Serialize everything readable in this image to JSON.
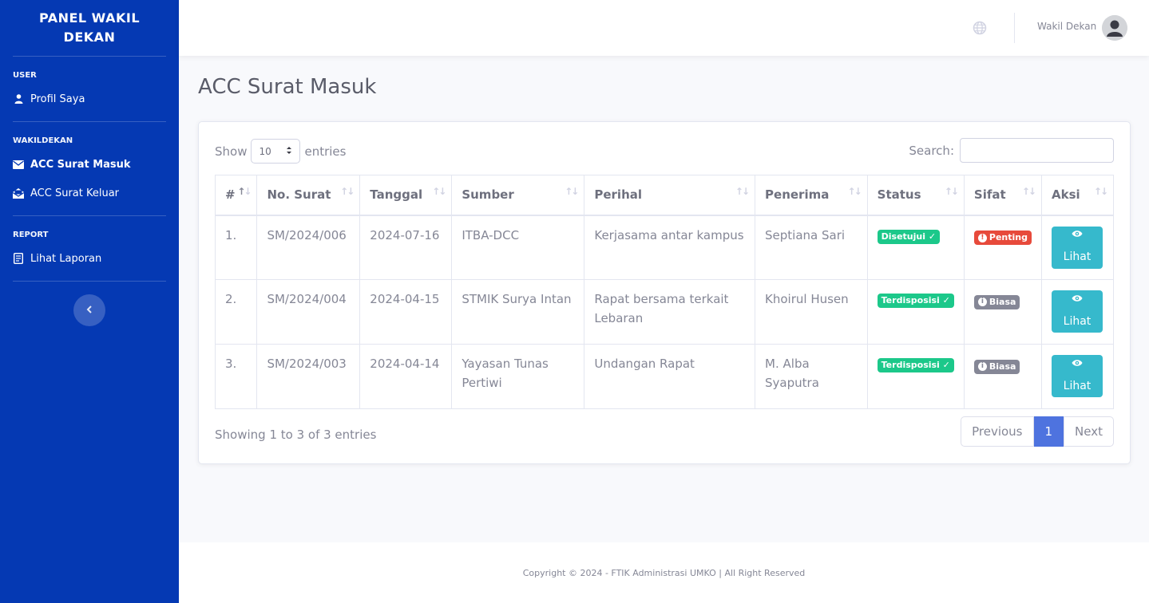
{
  "sidebar": {
    "brand": "PANEL WAKIL DEKAN",
    "sections": [
      {
        "heading": "USER",
        "items": [
          {
            "label": "Profil Saya",
            "icon": "user-icon"
          }
        ]
      },
      {
        "heading": "WAKILDEKAN",
        "items": [
          {
            "label": "ACC Surat Masuk",
            "icon": "envelope-icon"
          },
          {
            "label": "ACC Surat Keluar",
            "icon": "envelope-open-icon"
          }
        ]
      },
      {
        "heading": "REPORT",
        "items": [
          {
            "label": "Lihat Laporan",
            "icon": "report-icon"
          }
        ]
      }
    ],
    "toggle_icon": "chevron-left-icon"
  },
  "topbar": {
    "user_name": "Wakil Dekan"
  },
  "page": {
    "title": "ACC Surat Masuk"
  },
  "table_controls": {
    "show_label": "Show",
    "entries_value": "10",
    "entries_label": "entries",
    "search_label": "Search:",
    "search_value": ""
  },
  "table": {
    "columns": [
      "#",
      "No. Surat",
      "Tanggal",
      "Sumber",
      "Perihal",
      "Penerima",
      "Status",
      "Sifat",
      "Aksi"
    ],
    "rows": [
      {
        "no": "1.",
        "no_surat": "SM/2024/006",
        "tanggal": "2024-07-16",
        "sumber": "ITBA-DCC",
        "perihal": "Kerjasama antar kampus",
        "penerima": "Septiana Sari",
        "status": "Disetujui",
        "sifat": "Penting",
        "aksi": "Lihat"
      },
      {
        "no": "2.",
        "no_surat": "SM/2024/004",
        "tanggal": "2024-04-15",
        "sumber": "STMIK Surya Intan",
        "perihal": "Rapat bersama terkait Lebaran",
        "penerima": "Khoirul Husen",
        "status": "Terdisposisi",
        "sifat": "Biasa",
        "aksi": "Lihat"
      },
      {
        "no": "3.",
        "no_surat": "SM/2024/003",
        "tanggal": "2024-04-14",
        "sumber": "Yayasan Tunas Pertiwi",
        "perihal": "Undangan Rapat",
        "penerima": "M. Alba Syaputra",
        "status": "Terdisposisi",
        "sifat": "Biasa",
        "aksi": "Lihat"
      }
    ]
  },
  "table_info": "Showing 1 to 3 of 3 entries",
  "pagination": {
    "previous": "Previous",
    "current": "1",
    "next": "Next"
  },
  "footer": {
    "text": "Copyright © 2024 - FTIK Administrasi UMKO | All Right Reserved"
  },
  "colors": {
    "sidebar": "#0539b3",
    "primary": "#4e73df",
    "success": "#1cc88a",
    "danger": "#e74a3b",
    "info": "#36b9cc",
    "secondary": "#858796"
  }
}
